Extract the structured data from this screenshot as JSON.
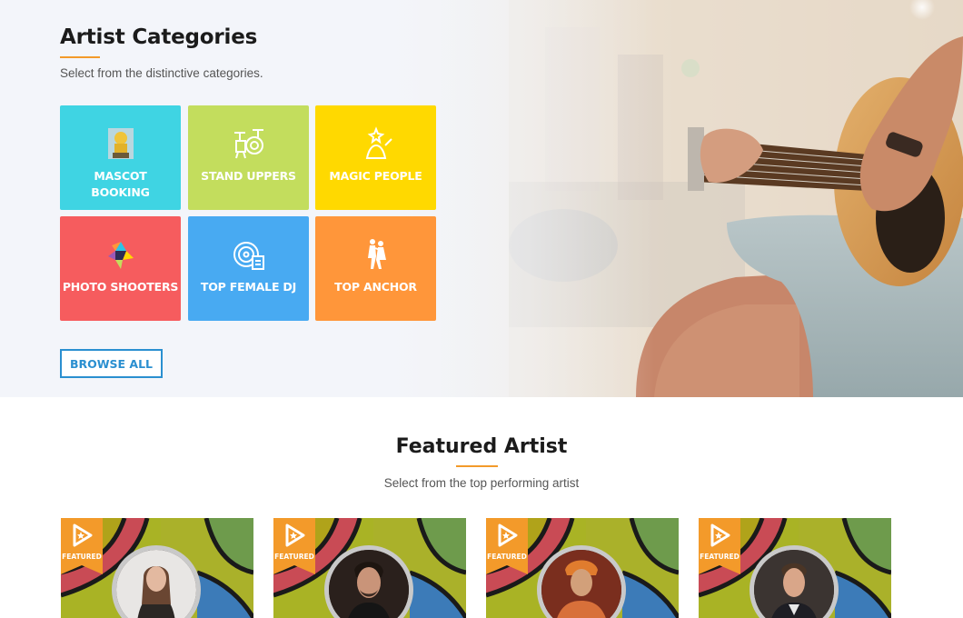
{
  "categories": {
    "title": "Artist Categories",
    "subtitle": "Select from the distinctive categories.",
    "tiles": [
      {
        "label_line1": "MASCOT",
        "label_line2": "BOOKING",
        "icon": "mascot-icon",
        "color": "#3fd4e3"
      },
      {
        "label_line1": "STAND UPPERS",
        "icon": "drum-kit-icon",
        "color": "#c3dd5d"
      },
      {
        "label_line1": "MAGIC PEOPLE",
        "icon": "magician-icon",
        "color": "#ffd900"
      },
      {
        "label_line1": "PHOTO SHOOTERS",
        "icon": "camera-aperture-icon",
        "color": "#f65c5e"
      },
      {
        "label_line1": "TOP FEMALE DJ",
        "icon": "dj-turntable-icon",
        "color": "#48aaf2"
      },
      {
        "label_line1": "TOP ANCHOR",
        "icon": "dancing-couple-icon",
        "color": "#ff963a"
      }
    ],
    "browse_label": "BROWSE ALL"
  },
  "featured": {
    "title": "Featured Artist",
    "subtitle": "Select from the top performing artist",
    "ribbon_label": "FEATURED",
    "accent": "#f39a2a",
    "cards": [
      {
        "avatar": "female-artist-photo"
      },
      {
        "avatar": "male-singer-photo"
      },
      {
        "avatar": "saint-costume-photo"
      },
      {
        "avatar": "male-presenter-photo"
      }
    ]
  },
  "colors": {
    "accent_orange": "#f39a2a",
    "button_blue": "#2a8fd0"
  }
}
